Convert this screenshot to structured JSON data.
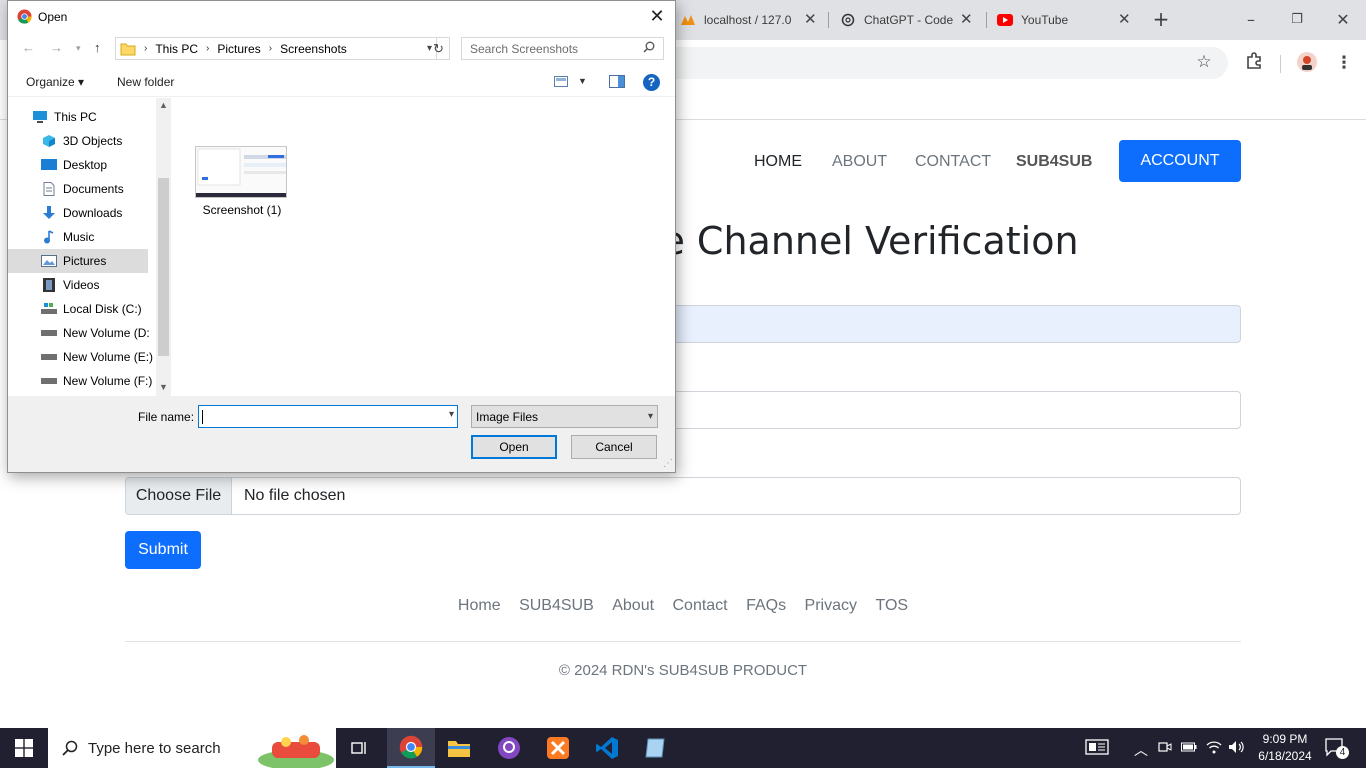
{
  "browser": {
    "tabs": [
      {
        "label": "localhost / 127.0",
        "icon": "phpmyadmin-icon"
      },
      {
        "label": "ChatGPT - Code",
        "icon": "chatgpt-icon"
      },
      {
        "label": "YouTube",
        "icon": "youtube-icon"
      }
    ],
    "new_tab": "+",
    "window_controls": {
      "minimize": "–",
      "restore": "❐",
      "close": "✕"
    }
  },
  "page": {
    "nav": {
      "home": "HOME",
      "about": "ABOUT",
      "contact": "CONTACT",
      "brand": "SUB4SUB",
      "account": "ACCOUNT"
    },
    "title": "e Channel Verification",
    "file_input": {
      "button": "Choose File",
      "status": "No file chosen"
    },
    "submit": "Submit",
    "footer": {
      "links": [
        "Home",
        "SUB4SUB",
        "About",
        "Contact",
        "FAQs",
        "Privacy",
        "TOS"
      ],
      "copyright": "© 2024 RDN's SUB4SUB PRODUCT"
    }
  },
  "dialog": {
    "title": "Open",
    "breadcrumb": [
      "This PC",
      "Pictures",
      "Screenshots"
    ],
    "search_placeholder": "Search Screenshots",
    "organize": "Organize ▾",
    "new_folder": "New folder",
    "help": "?",
    "tree": [
      {
        "label": "This PC",
        "icon": "pc-icon",
        "selected": false
      },
      {
        "label": "3D Objects",
        "icon": "3d-objects-icon",
        "selected": false
      },
      {
        "label": "Desktop",
        "icon": "desktop-icon",
        "selected": false
      },
      {
        "label": "Documents",
        "icon": "documents-icon",
        "selected": false
      },
      {
        "label": "Downloads",
        "icon": "downloads-icon",
        "selected": false
      },
      {
        "label": "Music",
        "icon": "music-icon",
        "selected": false
      },
      {
        "label": "Pictures",
        "icon": "pictures-icon",
        "selected": true
      },
      {
        "label": "Videos",
        "icon": "videos-icon",
        "selected": false
      },
      {
        "label": "Local Disk (C:)",
        "icon": "drive-icon",
        "selected": false
      },
      {
        "label": "New Volume (D:",
        "icon": "drive-icon",
        "selected": false
      },
      {
        "label": "New Volume (E:)",
        "icon": "drive-icon",
        "selected": false
      },
      {
        "label": "New Volume (F:)",
        "icon": "drive-icon",
        "selected": false
      }
    ],
    "files": [
      {
        "label": "Screenshot (1)"
      }
    ],
    "file_name_label": "File name:",
    "file_name_value": "",
    "file_type": "Image Files",
    "open": "Open",
    "cancel": "Cancel"
  },
  "taskbar": {
    "search_placeholder": "Type here to search",
    "time": "9:09 PM",
    "date": "6/18/2024",
    "notifications": "4"
  },
  "colors": {
    "primary": "#0d6efd",
    "taskbar": "#202030",
    "dialog_accent": "#0078d7"
  }
}
